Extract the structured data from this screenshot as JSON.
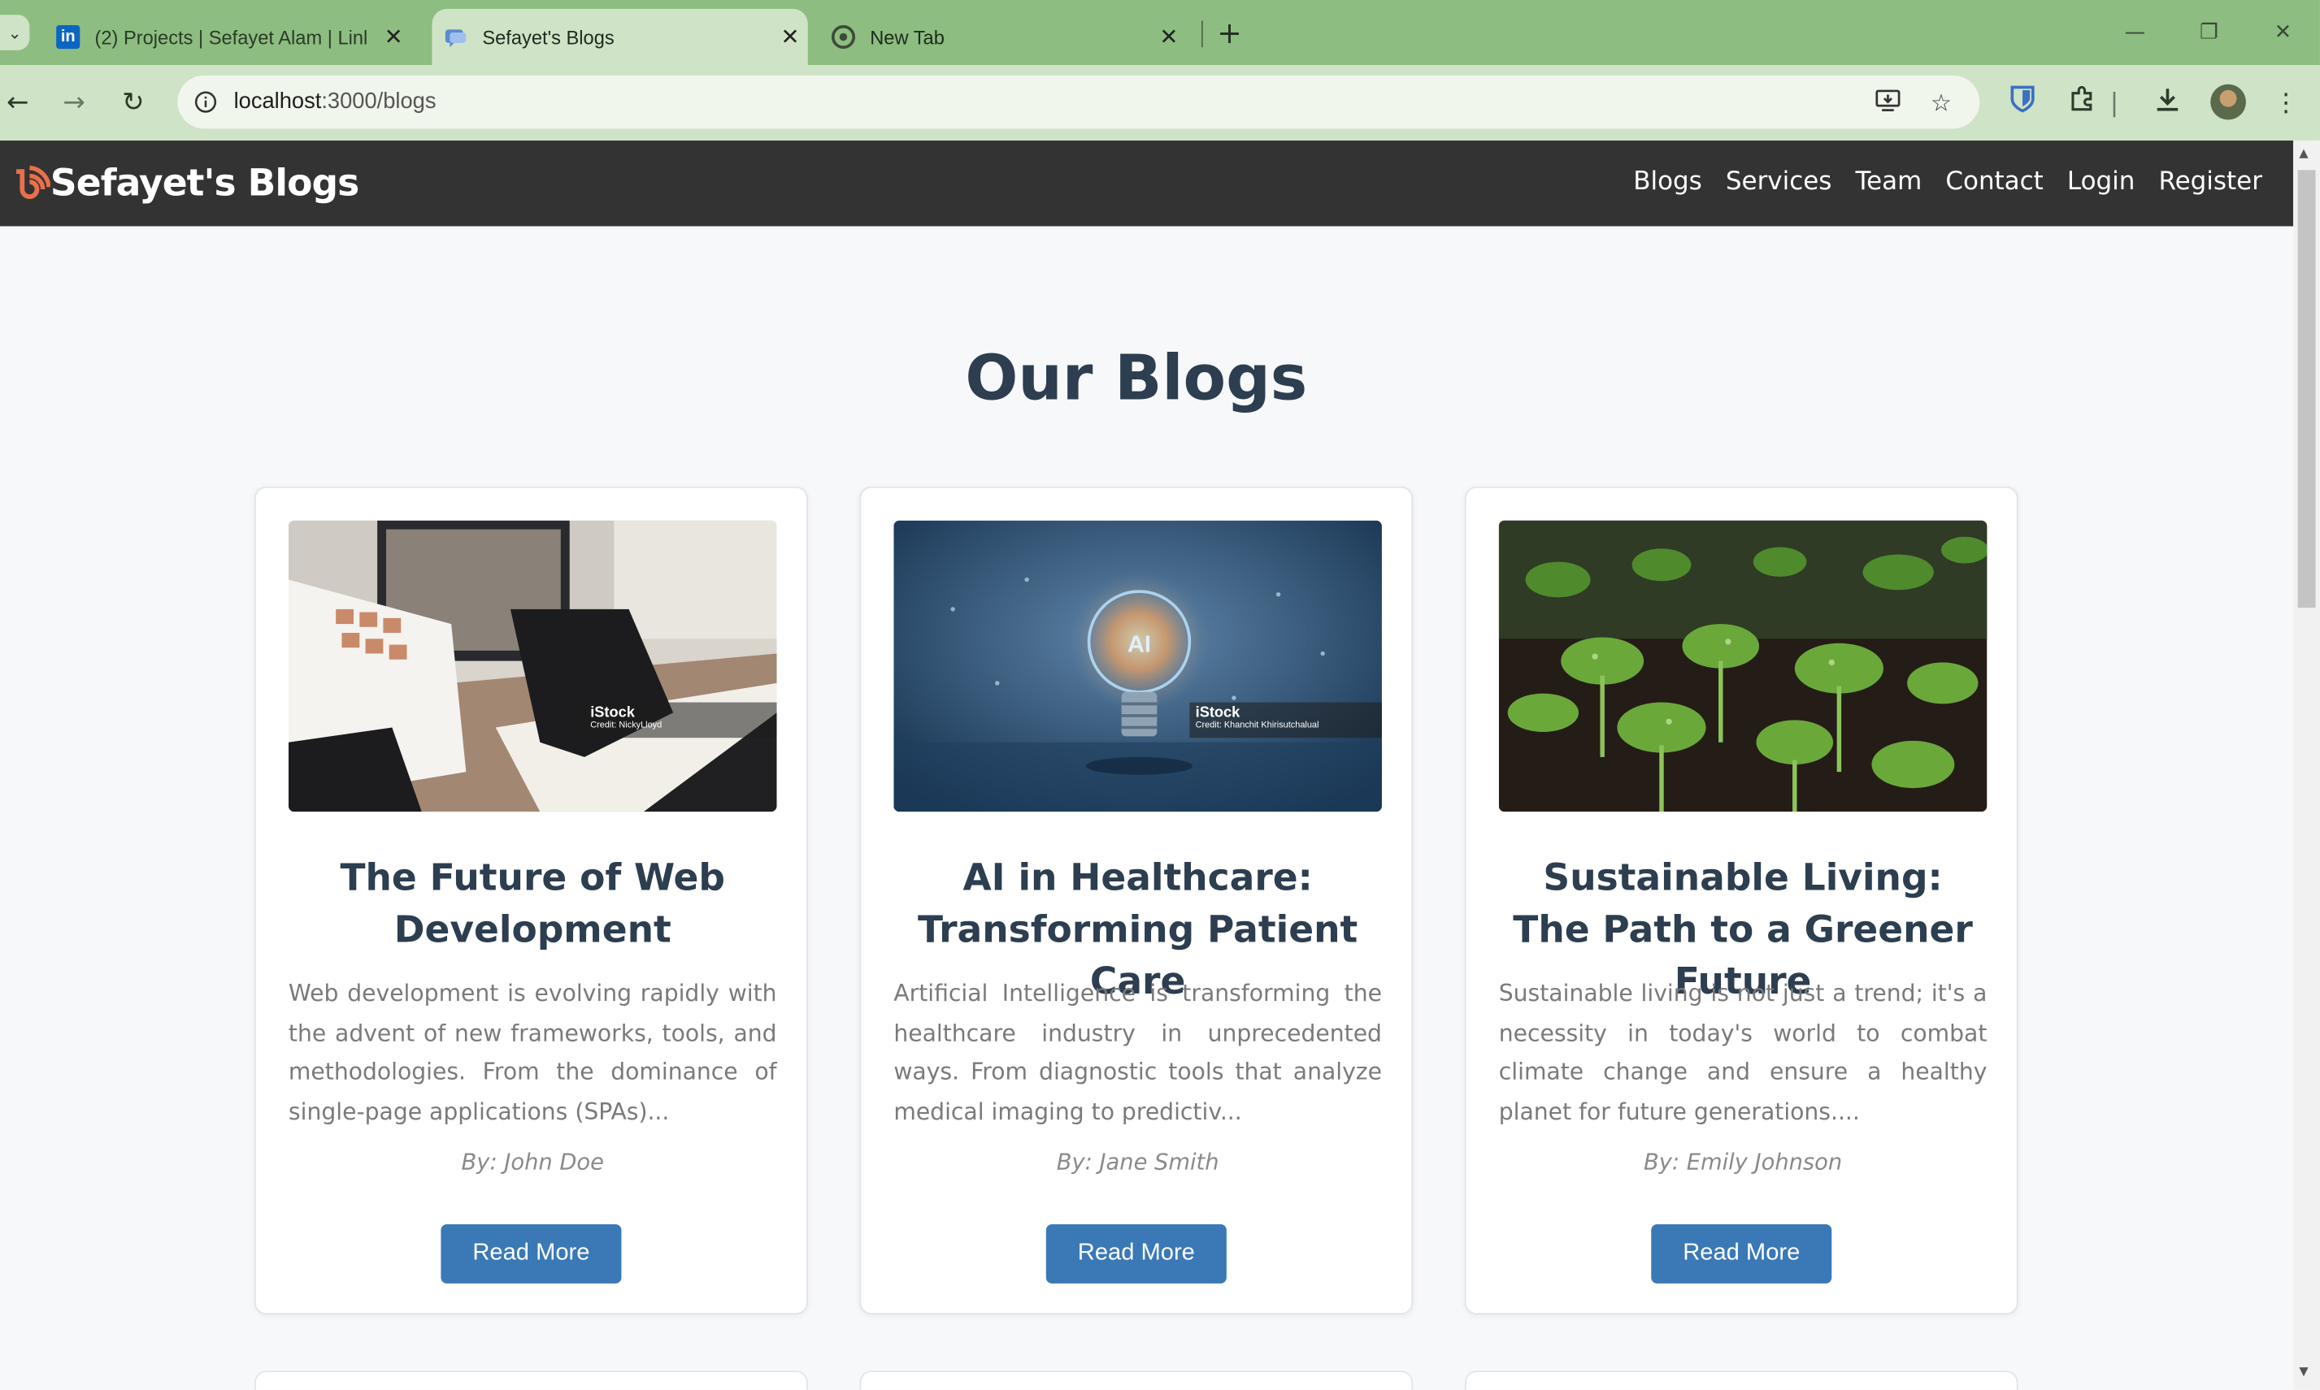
{
  "browser": {
    "tabs": [
      {
        "title": "(2) Projects | Sefayet Alam | Linl",
        "favicon": "linkedin-icon",
        "active": false
      },
      {
        "title": "Sefayet's Blogs",
        "favicon": "blog-icon",
        "active": true
      },
      {
        "title": "New Tab",
        "favicon": "chrome-icon",
        "active": false
      }
    ],
    "url_host": "localhost",
    "url_path": ":3000/blogs",
    "accent_color": "#8dbd80"
  },
  "nav": {
    "brand": "Sefayet's Blogs",
    "links": [
      "Blogs",
      "Services",
      "Team",
      "Contact",
      "Login",
      "Register"
    ]
  },
  "main": {
    "title": "Our Blogs",
    "cards": [
      {
        "title": "The Future of Web Development",
        "excerpt": "Web development is evolving rapidly with the advent of new frameworks, tools, and methodologies. From the dominance of single-page applications (SPAs)...",
        "author": "By: John Doe",
        "button": "Read More",
        "image_caption": "iStock",
        "image_credit": "Credit: NickyLloyd"
      },
      {
        "title": "AI in Healthcare: Transforming Patient Care",
        "excerpt": "Artificial Intelligence is transforming the healthcare industry in unprecedented ways. From diagnostic tools that analyze medical imaging to predictiv...",
        "author": "By: Jane Smith",
        "button": "Read More",
        "image_caption": "iStock",
        "image_credit": "Credit: Khanchit Khirisutchalual"
      },
      {
        "title": "Sustainable Living: The Path to a Greener Future",
        "excerpt": "Sustainable living is not just a trend; it's a necessity in today's world to combat climate change and ensure a healthy planet for future generations....",
        "author": "By: Emily Johnson",
        "button": "Read More"
      }
    ]
  }
}
